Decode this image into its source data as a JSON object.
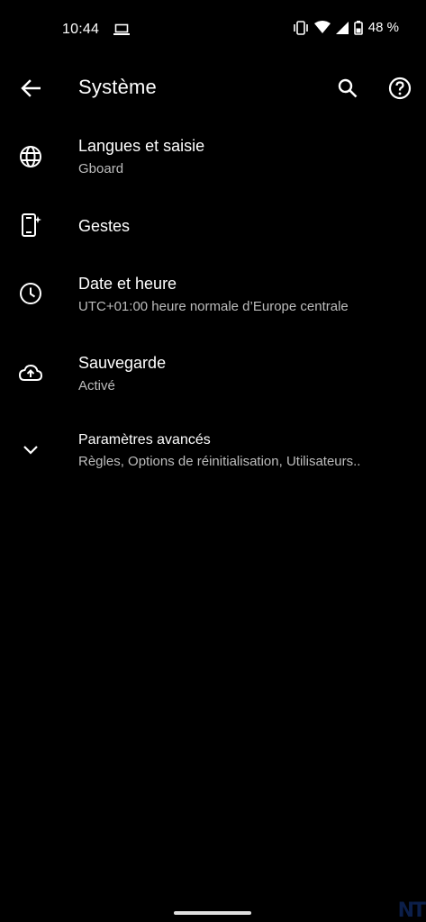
{
  "status_bar": {
    "time": "10:44",
    "battery_percent": "48 %",
    "icons": [
      "laptop-icon",
      "vibrate-icon",
      "wifi-icon",
      "signal-icon",
      "battery-icon"
    ]
  },
  "app_bar": {
    "title": "Système",
    "icons": [
      "back-arrow-icon",
      "search-icon",
      "help-icon"
    ]
  },
  "settings": [
    {
      "title": "Langues et saisie",
      "summary": "Gboard",
      "icon": "globe-icon"
    },
    {
      "title": "Gestes",
      "summary": "",
      "icon": "gesture-phone-icon"
    },
    {
      "title": "Date et heure",
      "summary": "UTC+01:00 heure normale d’Europe centrale",
      "icon": "clock-icon"
    },
    {
      "title": "Sauvegarde",
      "summary": "Activé",
      "icon": "cloud-upload-icon"
    },
    {
      "title": "Paramètres avancés",
      "summary": "Règles, Options de réinitialisation, Utilisateurs..",
      "icon": "chevron-down-icon"
    }
  ],
  "watermark": "NT",
  "colors": {
    "background": "#000000",
    "primary_text": "#ffffff",
    "secondary_text": "#bdbdbd"
  }
}
